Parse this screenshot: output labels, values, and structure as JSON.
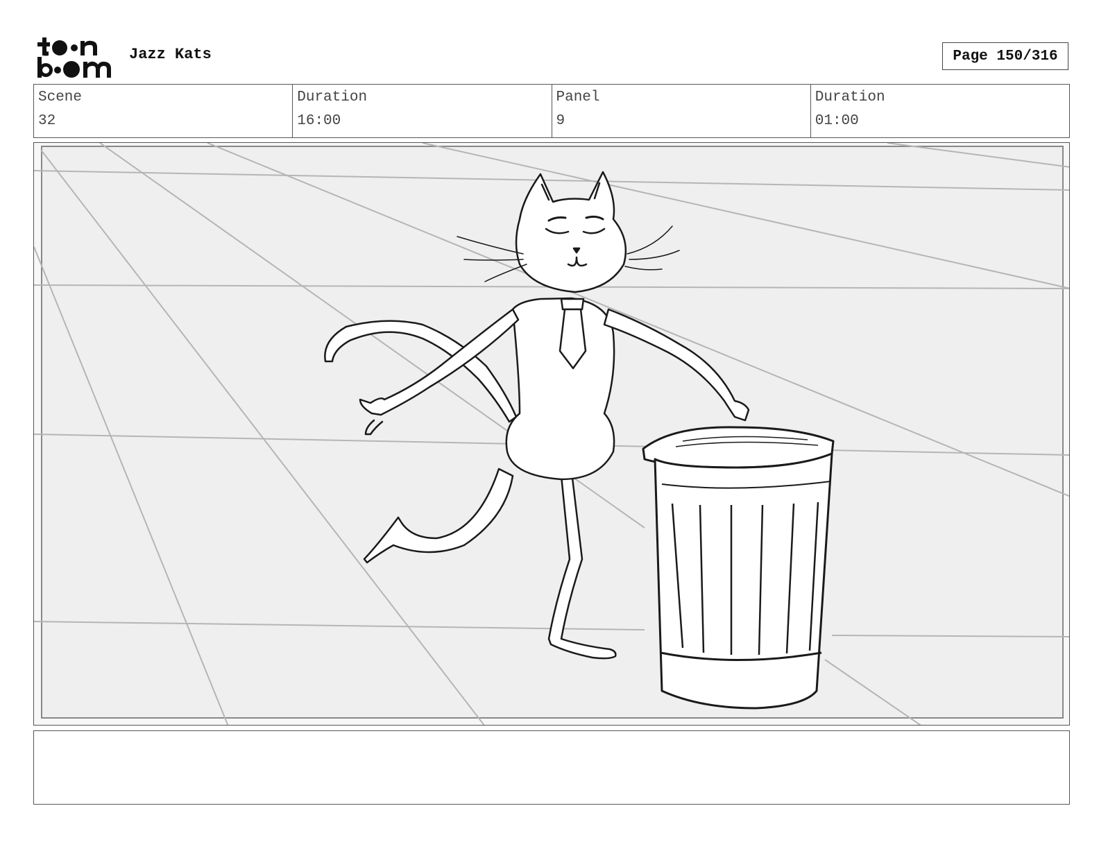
{
  "header": {
    "logo_name": "toon boom",
    "project_title": "Jazz Kats",
    "page_label": "Page 150/316"
  },
  "info": [
    {
      "label": "Scene",
      "value": "32"
    },
    {
      "label": "Duration",
      "value": "16:00"
    },
    {
      "label": "Panel",
      "value": "9"
    },
    {
      "label": "Duration",
      "value": "01:00"
    }
  ],
  "panel": {
    "description": "",
    "background_color": "#efefef",
    "line_color": "#1a1a1a",
    "grid_color": "#b5b5b5"
  },
  "notes": {
    "text": ""
  }
}
